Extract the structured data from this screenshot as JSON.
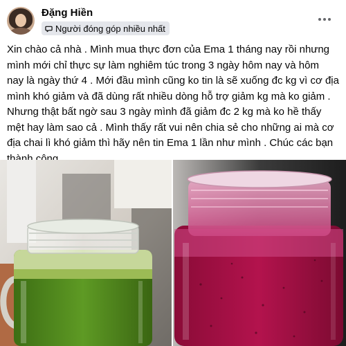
{
  "post": {
    "author": "Đặng Hiền",
    "badge": "Người đóng góp nhiều nhất",
    "icons": {
      "avatar": "profile-photo",
      "badge": "speech-bubble-icon",
      "more": "more-horizontal-icon"
    },
    "lines": [
      "Xin chào cả nhà . Mình mua thực đơn của Ema 1 tháng nay rồi nhưng",
      "mình mới chỉ thực sự làm nghiêm túc trong 3 ngày hôm nay và hôm",
      "nay là ngày thứ 4 . Mới đầu mình cũng ko tin là sẽ xuống đc kg vì cơ địa",
      "mình khó giảm và đã dùng rất nhiều dòng hỗ trợ giảm kg mà ko giảm .",
      "Nhưng thật bất ngờ sau 3 ngày mình đã giảm đc 2 kg mà ko hề thấy",
      "mệt hay làm sao cả . Mình thấy rất vui nên chia sẻ cho những ai mà cơ",
      "địa chai lì khó giảm thì hãy nên tin Ema 1 lần như mình . Chúc các bạn",
      "thành công"
    ]
  },
  "photos": [
    {
      "subject": "green smoothie in glass jar",
      "drink_color": "#4f8a1e"
    },
    {
      "subject": "dark pink smoothie in glass jar",
      "drink_color": "#b0104a"
    }
  ]
}
